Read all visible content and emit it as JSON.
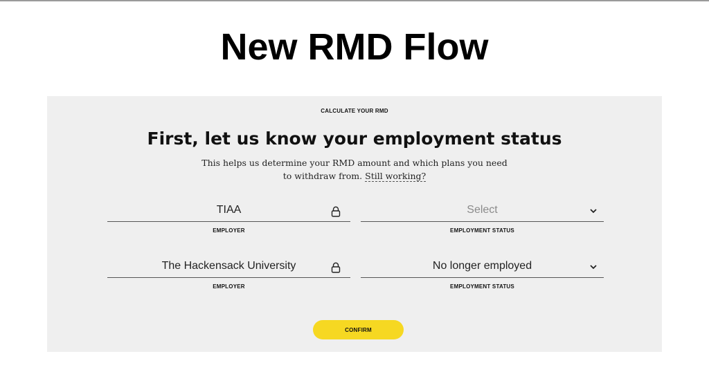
{
  "slide": {
    "title": "New RMD Flow"
  },
  "form": {
    "eyebrow": "CALCULATE YOUR RMD",
    "heading": "First, let us know your employment status",
    "subtext_line1": "This helps us determine your RMD amount and which plans you need",
    "subtext_line2": "to withdraw from.",
    "still_working_link": "Still working?",
    "rows": [
      {
        "employer": {
          "value": "TIAA",
          "label": "EMPLOYER",
          "icon": "lock-icon"
        },
        "status": {
          "value": "Select",
          "label": "EMPLOYMENT STATUS",
          "icon": "chevron-down-icon",
          "is_placeholder": true
        }
      },
      {
        "employer": {
          "value": "The Hackensack University",
          "label": "EMPLOYER",
          "icon": "lock-icon"
        },
        "status": {
          "value": "No longer employed",
          "label": "EMPLOYMENT STATUS",
          "icon": "chevron-down-icon",
          "is_placeholder": false
        }
      }
    ],
    "confirm_label": "CONFIRM"
  },
  "colors": {
    "panel_bg": "#efefef",
    "confirm_button": "#f6d822",
    "field_underline": "#555555",
    "placeholder_text": "#8a8a8a"
  }
}
